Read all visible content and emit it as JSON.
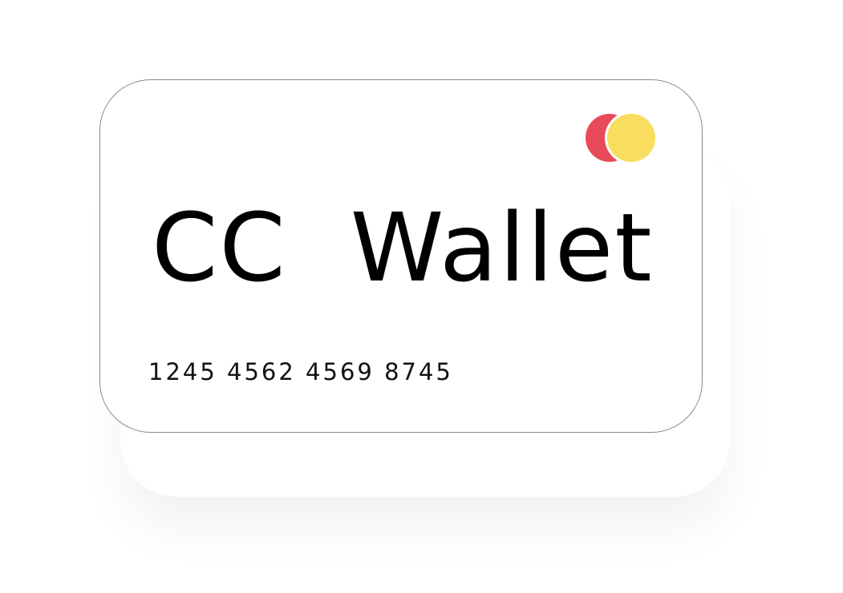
{
  "card": {
    "title": "CC  Wallet",
    "number": "1245 4562 4569 8745"
  },
  "logo": {
    "icon": "card-network-logo-icon",
    "left_circle_color": "#E84A5A",
    "right_circle_color": "#F8DD5E"
  }
}
